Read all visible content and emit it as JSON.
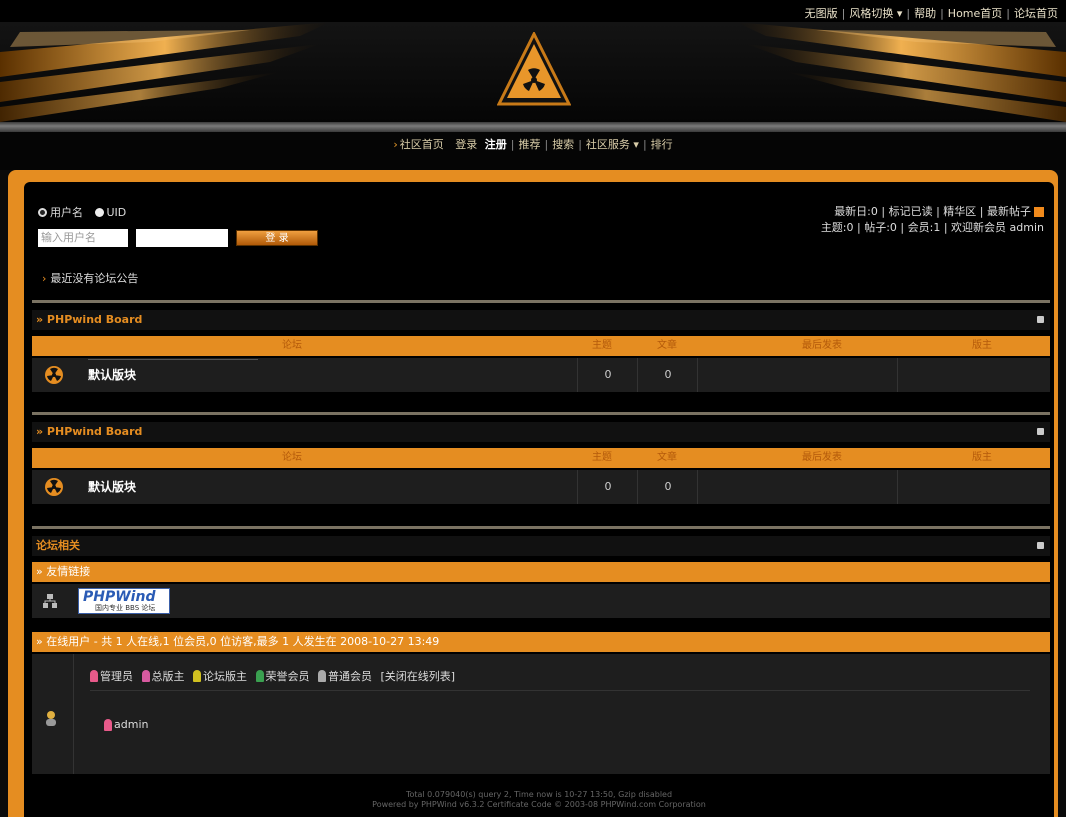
{
  "top_links": [
    "无图版",
    "风格切换 ▾",
    "帮助",
    "Home首页",
    "论坛首页"
  ],
  "nav": {
    "items": [
      "社区首页",
      "登录",
      "注册",
      "推荐",
      "搜索",
      "社区服务 ▾",
      "排行"
    ]
  },
  "login": {
    "option_username": "用户名",
    "option_uid": "UID",
    "username_placeholder": "输入用户名",
    "submit_label": "登 录",
    "notice": "最近没有论坛公告"
  },
  "stats": {
    "line1": "最新日:0 | 标记已读 | 精华区 | 最新帖子",
    "line2": "主题:0 | 帖子:0 | 会员:1 | 欢迎新会员 admin"
  },
  "boards": [
    {
      "title": "» PHPwind Board",
      "columns": [
        "论坛",
        "主题",
        "文章",
        "最后发表",
        "版主"
      ],
      "forum_name": "默认版块",
      "topics": "0",
      "posts": "0"
    },
    {
      "title": "» PHPwind Board",
      "columns": [
        "论坛",
        "主题",
        "文章",
        "最后发表",
        "版主"
      ],
      "forum_name": "默认版块",
      "topics": "0",
      "posts": "0"
    }
  ],
  "related": {
    "title": "论坛相关",
    "links_title": "» 友情链接",
    "logo_text": "PHPWind",
    "logo_subtext": "国内专业 BBS 论坛",
    "online_title": "» 在线用户 - 共 1 人在线,1 位会员,0 位访客,最多 1 人发生在 2008-10-27 13:49",
    "legend": [
      "管理员",
      "总版主",
      "论坛版主",
      "荣誉会员",
      "普通会员"
    ],
    "legend_link": "[关闭在线列表]",
    "user": "admin"
  },
  "colors": {
    "accent": "#e58d21",
    "admin": "#e85a8a",
    "super_mod": "#e85a8a",
    "forum_mod": "#d0c020",
    "honor": "#3aa050",
    "member": "#aaaaaa"
  },
  "footer": {
    "line1": "Total 0.079040(s) query 2, Time now is 10-27 13:50, Gzip disabled",
    "line2": "Powered by PHPWind v6.3.2 Certificate Code © 2003-08 PHPWind.com Corporation"
  }
}
